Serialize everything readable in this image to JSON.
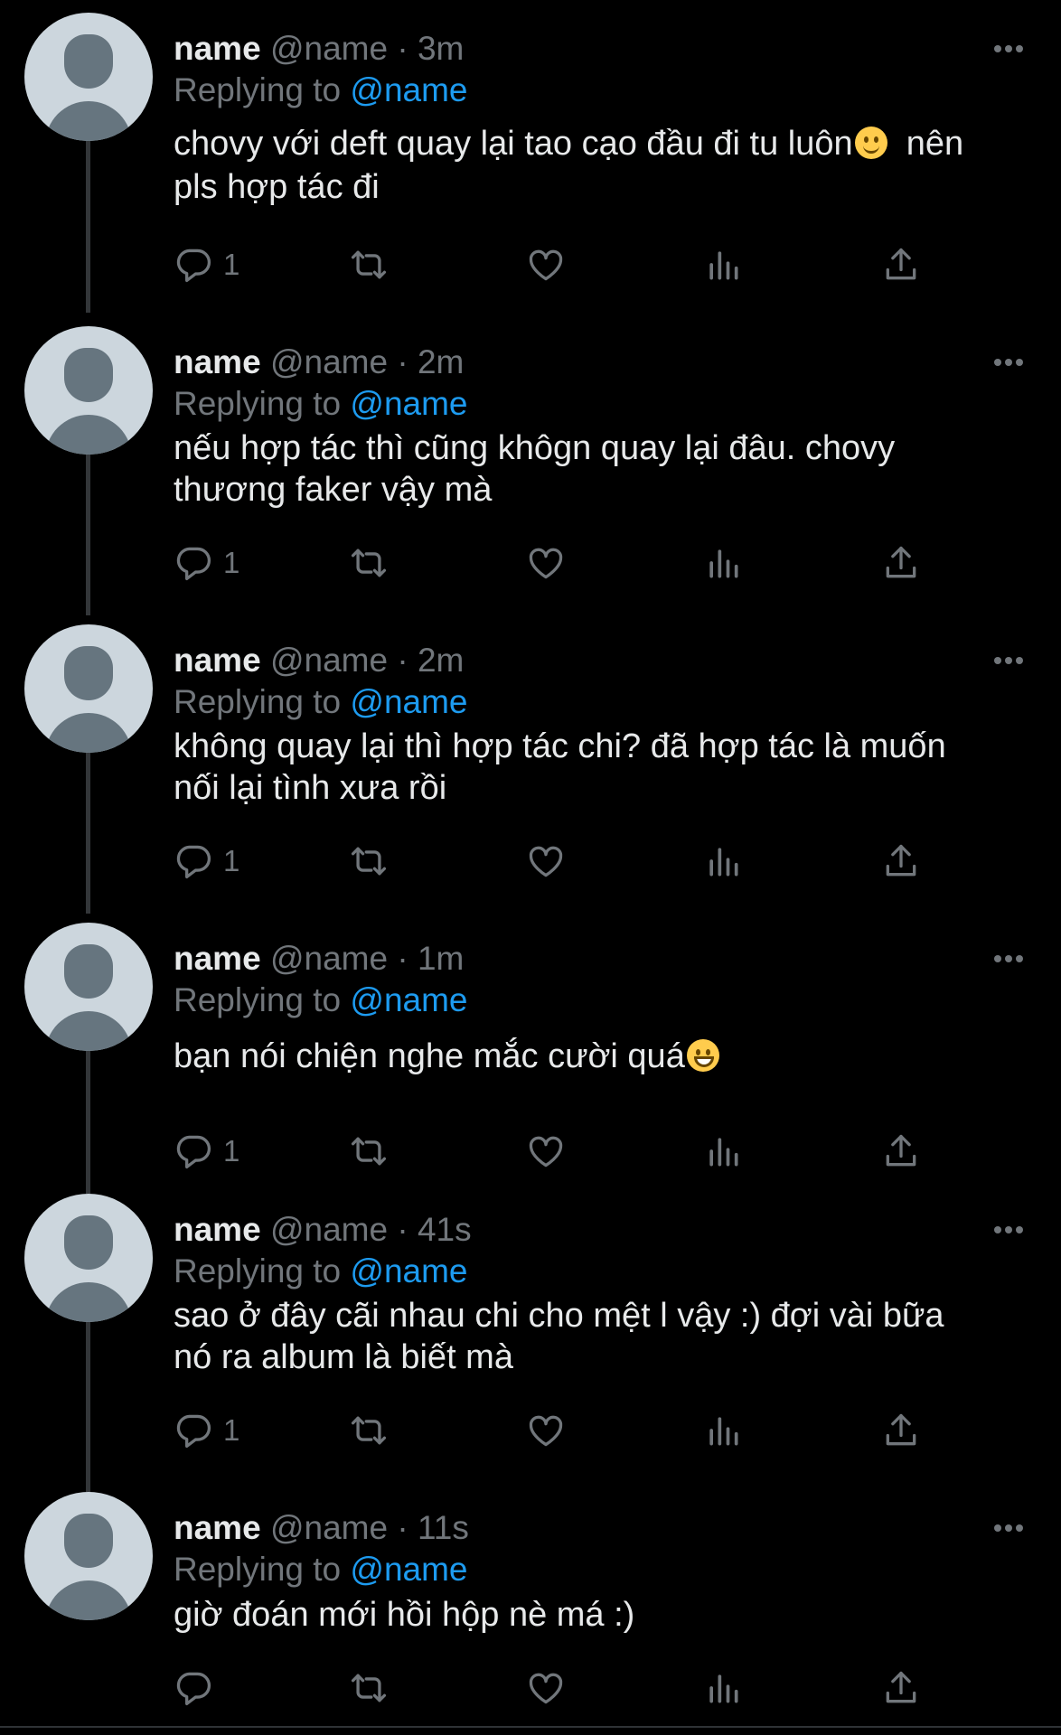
{
  "colors": {
    "background": "#000000",
    "text_primary": "#e7e9ea",
    "text_secondary": "#71767b",
    "link": "#1d9bf0",
    "avatar_bg": "#ccd6dd",
    "avatar_fg": "#66757f"
  },
  "icons": {
    "more": "ellipsis-icon",
    "reply": "speech-bubble-icon",
    "retweet": "retweet-icon",
    "like": "heart-icon",
    "views": "bar-chart-icon",
    "share": "share-upload-icon"
  },
  "tweets": [
    {
      "display_name": "name",
      "handle": "@name",
      "separator": "·",
      "time": "3m",
      "replying_prefix": "Replying to",
      "replying_to": "@name",
      "text_line1": "chovy với deft quay lại tao cạo đầu đi tu luôn",
      "emoji": "🙂",
      "text_line1_tail": "  nên",
      "text_line2": "pls hợp tác đi",
      "reply_count": "1"
    },
    {
      "display_name": "name",
      "handle": "@name",
      "separator": "·",
      "time": "2m",
      "replying_prefix": "Replying to",
      "replying_to": "@name",
      "text_line1": "nếu hợp tác thì cũng khôgn quay lại đâu. chovy",
      "text_line2": "thương faker vậy mà",
      "reply_count": "1"
    },
    {
      "display_name": "name",
      "handle": "@name",
      "separator": "·",
      "time": "2m",
      "replying_prefix": "Replying to",
      "replying_to": "@name",
      "text_line1": "không quay lại thì hợp tác chi? đã hợp tác là muốn",
      "text_line2": "nối lại tình xưa rồi",
      "reply_count": "1"
    },
    {
      "display_name": "name",
      "handle": "@name",
      "separator": "·",
      "time": "1m",
      "replying_prefix": "Replying to",
      "replying_to": "@name",
      "text_line1": "bạn nói chiện nghe mắc cười quá",
      "emoji": "😀",
      "reply_count": "1"
    },
    {
      "display_name": "name",
      "handle": "@name",
      "separator": "·",
      "time": "41s",
      "replying_prefix": "Replying to",
      "replying_to": "@name",
      "text_line1": "sao ở đây cãi nhau chi cho mệt l vậy :) đợi vài bữa",
      "text_line2": "nó ra album là biết mà",
      "reply_count": "1"
    },
    {
      "display_name": "name",
      "handle": "@name",
      "separator": "·",
      "time": "11s",
      "replying_prefix": "Replying to",
      "replying_to": "@name",
      "text_line1": "giờ đoán mới hồi hộp nè má :)",
      "reply_count": ""
    }
  ]
}
